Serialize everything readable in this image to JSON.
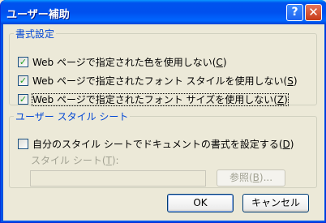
{
  "window": {
    "title": "ユーザー補助",
    "help_glyph": "?",
    "close_glyph": "✕"
  },
  "formatting": {
    "legend": "書式設定",
    "options": [
      {
        "text": "Web ページで指定された色を使用しない(",
        "key": "C",
        "suffix": ")",
        "checked": true
      },
      {
        "text": "Web ページで指定されたフォント スタイルを使用しない(",
        "key": "S",
        "suffix": ")",
        "checked": true
      },
      {
        "text": "Web ページで指定されたフォント サイズを使用しない(",
        "key": "Z",
        "suffix": ")",
        "checked": true
      }
    ]
  },
  "stylesheet": {
    "legend": "ユーザー スタイル シート",
    "option": {
      "text": "自分のスタイル シートでドキュメントの書式を設定する(",
      "key": "D",
      "suffix": ")",
      "checked": false
    },
    "field_label_text": "スタイル シート(",
    "field_label_key": "T",
    "field_label_suffix": "):",
    "field_value": "",
    "browse_text": "参照(",
    "browse_key": "B",
    "browse_suffix": ")..."
  },
  "buttons": {
    "ok": "OK",
    "cancel": "キャンセル"
  }
}
